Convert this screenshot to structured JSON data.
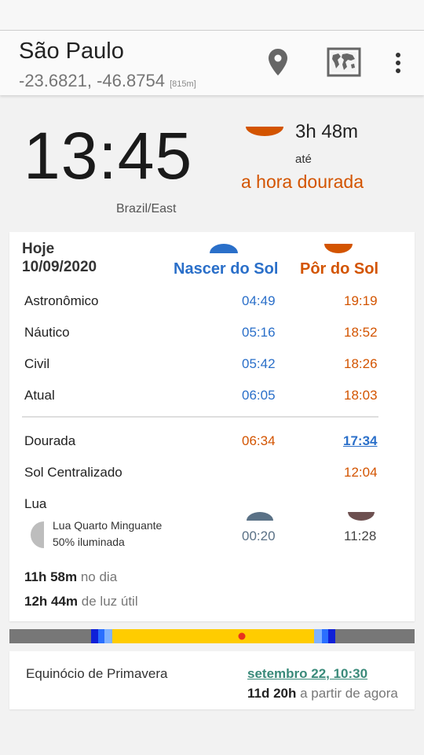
{
  "header": {
    "city": "São Paulo",
    "coordinates": "-23.6821, -46.8754",
    "elevation": "[815m]",
    "icons": [
      "location-pin-icon",
      "world-map-icon",
      "more-vert-icon"
    ]
  },
  "clock": {
    "time": "13:45",
    "timezone": "Brazil/East",
    "countdown": "3h 48m",
    "until": "até",
    "next_event": "a hora dourada"
  },
  "table": {
    "today_label": "Hoje",
    "date": "10/09/2020",
    "sunrise_header": "Nascer do Sol",
    "sunset_header": "Pôr do Sol",
    "rows": [
      {
        "label": "Astronômico",
        "rise": "04:49",
        "set": "19:19"
      },
      {
        "label": "Náutico",
        "rise": "05:16",
        "set": "18:52"
      },
      {
        "label": "Civil",
        "rise": "05:42",
        "set": "18:26"
      },
      {
        "label": "Atual",
        "rise": "06:05",
        "set": "18:03"
      }
    ],
    "golden": {
      "label": "Dourada",
      "rise": "06:34",
      "set": "17:34"
    },
    "noon": {
      "label": "Sol Centralizado",
      "time": "12:04"
    },
    "moon": {
      "label": "Lua",
      "phase": "Lua Quarto Minguante",
      "illumination": "50% iluminada",
      "rise": "00:20",
      "set": "11:28"
    },
    "day_length": {
      "value": "11h 58m",
      "suffix": "no dia"
    },
    "light_length": {
      "value": "12h 44m",
      "suffix": "de luz útil"
    }
  },
  "equinox": {
    "label": "Equinócio de Primavera",
    "date": "setembro 22, 10:30",
    "remaining": "11d 20h",
    "remaining_suffix": "a partir de agora"
  },
  "colors": {
    "sunrise": "#2a6fc9",
    "sunset": "#d35400",
    "day": "#ffcc00",
    "night": "#777777"
  }
}
